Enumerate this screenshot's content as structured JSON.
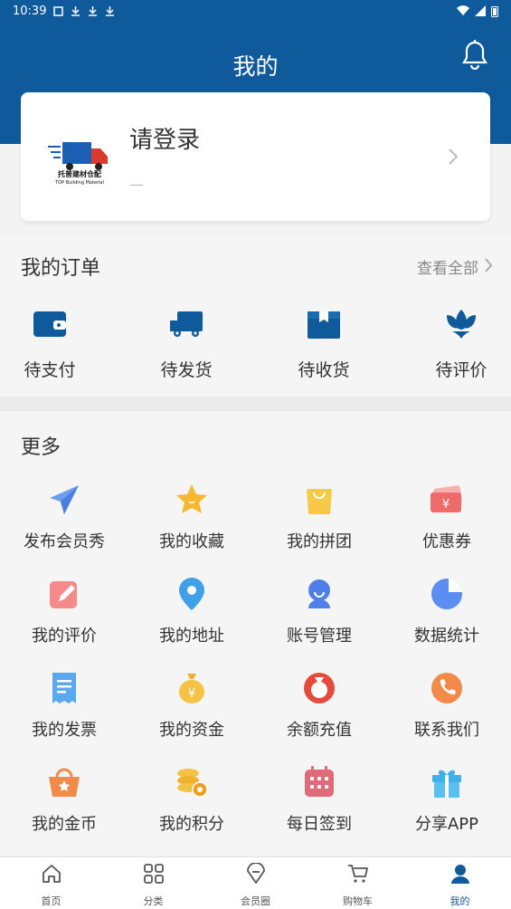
{
  "status": {
    "time": "10:39"
  },
  "header": {
    "title": "我的"
  },
  "login": {
    "title": "请登录",
    "subtitle": "—",
    "logo_text": "托普建材仓配",
    "logo_sub": "TOP Building Material"
  },
  "orders": {
    "title": "我的订单",
    "view_all": "查看全部",
    "items": [
      {
        "label": "待支付",
        "icon": "wallet-icon"
      },
      {
        "label": "待发货",
        "icon": "truck-icon"
      },
      {
        "label": "待收货",
        "icon": "box-icon"
      },
      {
        "label": "待评价",
        "icon": "flower-icon"
      }
    ]
  },
  "more": {
    "title": "更多",
    "items": [
      {
        "label": "发布会员秀",
        "icon": "paper-plane-icon"
      },
      {
        "label": "我的收藏",
        "icon": "star-icon"
      },
      {
        "label": "我的拼团",
        "icon": "shopping-bag-icon"
      },
      {
        "label": "优惠券",
        "icon": "coupon-icon"
      },
      {
        "label": "我的评价",
        "icon": "edit-icon"
      },
      {
        "label": "我的地址",
        "icon": "location-icon"
      },
      {
        "label": "账号管理",
        "icon": "user-icon"
      },
      {
        "label": "数据统计",
        "icon": "pie-chart-icon"
      },
      {
        "label": "我的发票",
        "icon": "invoice-icon"
      },
      {
        "label": "我的资金",
        "icon": "money-bag-icon"
      },
      {
        "label": "余额充值",
        "icon": "recharge-icon"
      },
      {
        "label": "联系我们",
        "icon": "phone-icon"
      },
      {
        "label": "我的金币",
        "icon": "basket-icon"
      },
      {
        "label": "我的积分",
        "icon": "coins-icon"
      },
      {
        "label": "每日签到",
        "icon": "calendar-icon"
      },
      {
        "label": "分享APP",
        "icon": "gift-icon"
      }
    ]
  },
  "tabbar": [
    {
      "label": "首页",
      "icon": "home-icon",
      "active": false
    },
    {
      "label": "分类",
      "icon": "category-icon",
      "active": false
    },
    {
      "label": "会员圈",
      "icon": "diamond-icon",
      "active": false
    },
    {
      "label": "购物车",
      "icon": "cart-icon",
      "active": false
    },
    {
      "label": "我的",
      "icon": "profile-icon",
      "active": true
    }
  ],
  "colors": {
    "brand": "#0f5a9a",
    "tab_active": "#0f5a9a"
  }
}
